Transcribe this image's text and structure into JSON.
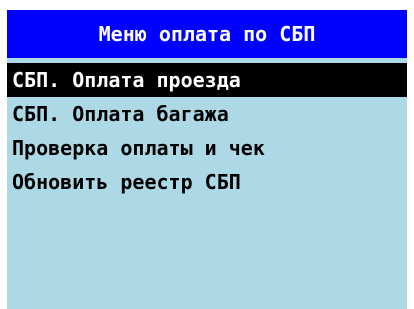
{
  "header": {
    "title": "Меню оплата по СБП"
  },
  "menu": {
    "items": [
      {
        "label": "СБП. Оплата проезда",
        "selected": true
      },
      {
        "label": "СБП. Оплата багажа",
        "selected": false
      },
      {
        "label": "Проверка оплаты и чек",
        "selected": false
      },
      {
        "label": "Обновить реестр СБП",
        "selected": false
      }
    ]
  },
  "colors": {
    "header_bg": "#0000ff",
    "header_text": "#ffffff",
    "screen_bg": "#add8e6",
    "selected_bg": "#000000",
    "selected_text": "#ffffff",
    "item_text": "#000000"
  }
}
